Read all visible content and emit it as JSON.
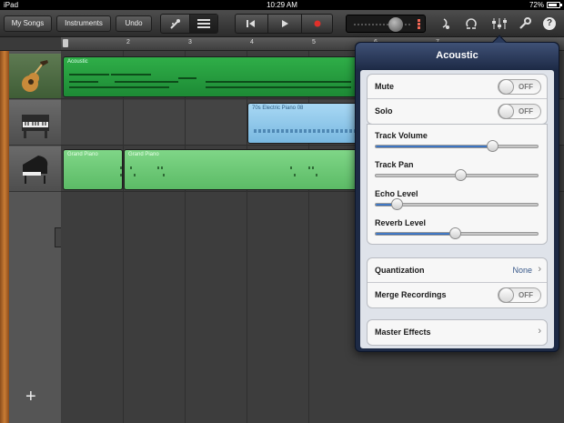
{
  "status": {
    "device": "iPad",
    "time": "10:29 AM",
    "battery": "72%"
  },
  "toolbar": {
    "my_songs": "My Songs",
    "instruments": "Instruments",
    "undo": "Undo"
  },
  "ruler": {
    "bars": [
      "1",
      "2",
      "3",
      "4",
      "5",
      "6",
      "7"
    ]
  },
  "tracks": [
    {
      "instrument": "acoustic-guitar-icon",
      "selected": true
    },
    {
      "instrument": "electric-piano-icon",
      "selected": false
    },
    {
      "instrument": "grand-piano-icon",
      "selected": false
    }
  ],
  "regions": {
    "acoustic": "Acoustic",
    "electric_piano": "70s Electric Piano 08",
    "grand_piano_1": "Grand Piano",
    "grand_piano_2": "Grand Piano"
  },
  "add_track": "+",
  "popover": {
    "title": "Acoustic",
    "mute": {
      "label": "Mute",
      "state": "OFF"
    },
    "solo": {
      "label": "Solo",
      "state": "OFF"
    },
    "sliders": [
      {
        "label": "Track Volume",
        "value": 0.72
      },
      {
        "label": "Track Pan",
        "value": 0.52
      },
      {
        "label": "Echo Level",
        "value": 0.13
      },
      {
        "label": "Reverb Level",
        "value": 0.49
      }
    ],
    "quantization": {
      "label": "Quantization",
      "value": "None"
    },
    "merge": {
      "label": "Merge Recordings",
      "state": "OFF"
    },
    "master_effects": {
      "label": "Master Effects"
    }
  },
  "colors": {
    "selected_track": "#2fae48",
    "slider_fill": "#2a63b3",
    "record": "#e0302a"
  }
}
